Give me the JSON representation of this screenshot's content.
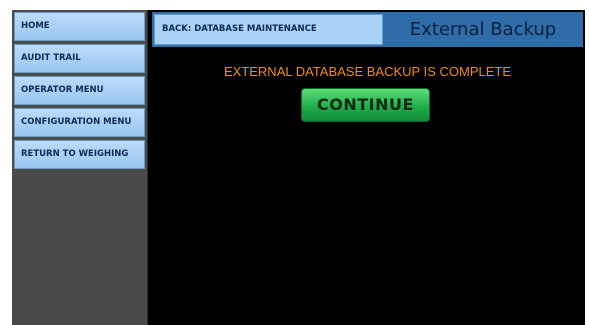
{
  "sidebar": {
    "items": [
      {
        "label": "HOME"
      },
      {
        "label": "AUDIT TRAIL"
      },
      {
        "label": "OPERATOR MENU"
      },
      {
        "label": "CONFIGURATION MENU"
      },
      {
        "label": "RETURN TO WEIGHING"
      }
    ]
  },
  "header": {
    "back_label": "BACK: DATABASE MAINTENANCE",
    "title": "External Backup"
  },
  "main": {
    "status_message": "EXTERNAL DATABASE BACKUP IS COMPLETE",
    "continue_label": "CONTINUE"
  },
  "colors": {
    "menu_button": "#a9d2f6",
    "header_bar": "#2f6caa",
    "status_text": "#f28a1a",
    "continue_button": "#1fae4a",
    "background": "#000000",
    "sidebar_bg": "#4a4a4a"
  }
}
